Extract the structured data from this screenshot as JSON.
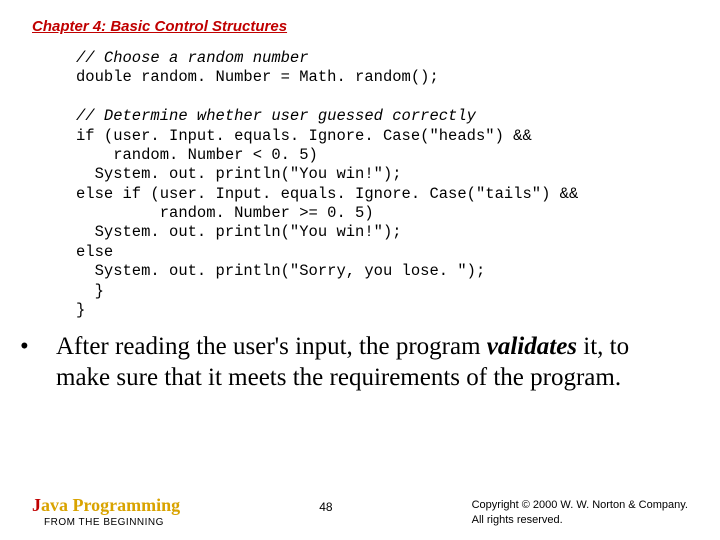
{
  "header": {
    "chapter_title": "Chapter 4: Basic Control Structures"
  },
  "code": {
    "c1": "// Choose a random number",
    "l2": "double random. Number = Math. random();",
    "c3": "// Determine whether user guessed correctly",
    "l4": "if (user. Input. equals. Ignore. Case(\"heads\") &&",
    "l5": "    random. Number < 0. 5)",
    "l6": "  System. out. println(\"You win!\");",
    "l7": "else if (user. Input. equals. Ignore. Case(\"tails\") &&",
    "l8": "         random. Number >= 0. 5)",
    "l9": "  System. out. println(\"You win!\");",
    "l10": "else",
    "l11": "  System. out. println(\"Sorry, you lose. \");",
    "l12": "  }",
    "l13": "}"
  },
  "bullet": {
    "pre": "After reading the user's input, the program ",
    "validates": "validates",
    "post": " it, to make sure that it meets the requirements of the program."
  },
  "footer": {
    "book_title_j": "J",
    "book_title_rest": "ava Programming",
    "book_sub": "FROM THE BEGINNING",
    "page_num": "48",
    "copyright_l1": "Copyright © 2000 W. W. Norton & Company.",
    "copyright_l2": "All rights reserved."
  }
}
